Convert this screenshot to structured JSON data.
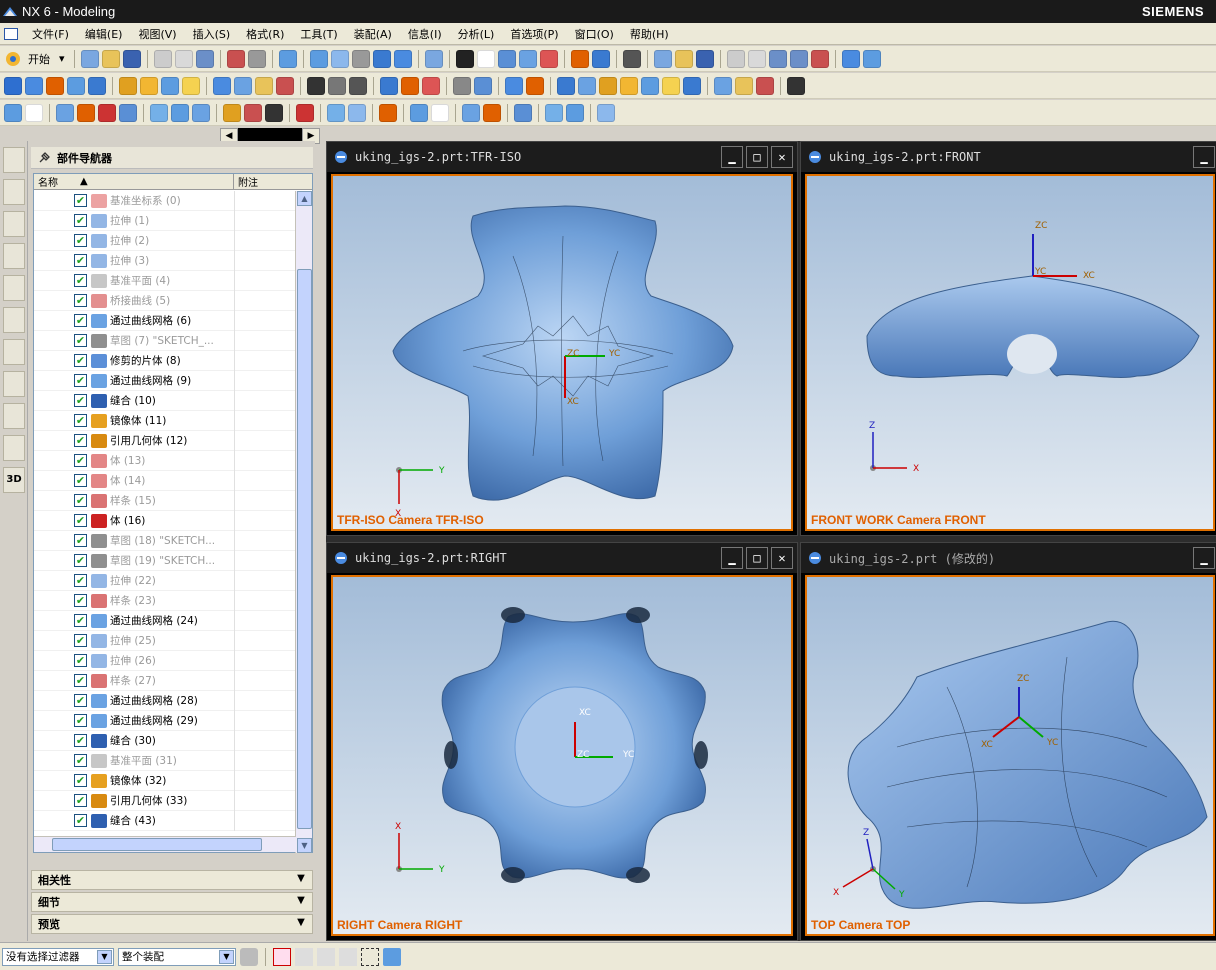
{
  "window": {
    "title": "NX 6 - Modeling",
    "brand": "SIEMENS"
  },
  "menu": [
    "文件(F)",
    "编辑(E)",
    "视图(V)",
    "插入(S)",
    "格式(R)",
    "工具(T)",
    "装配(A)",
    "信息(I)",
    "分析(L)",
    "首选项(P)",
    "窗口(O)",
    "帮助(H)"
  ],
  "toolbar": {
    "start_label": "开始"
  },
  "navigator": {
    "title": "部件导航器",
    "col_name": "名称",
    "col_note": "附注",
    "rows": [
      {
        "label": "基准坐标系 (0)",
        "icon": "datum-csys-icon",
        "dim": true
      },
      {
        "label": "拉伸 (1)",
        "icon": "extrude-icon",
        "dim": true
      },
      {
        "label": "拉伸 (2)",
        "icon": "extrude-icon",
        "dim": true
      },
      {
        "label": "拉伸 (3)",
        "icon": "extrude-icon",
        "dim": true
      },
      {
        "label": "基准平面 (4)",
        "icon": "datum-plane-icon",
        "dim": true
      },
      {
        "label": "桥接曲线 (5)",
        "icon": "bridge-curve-icon",
        "dim": true
      },
      {
        "label": "通过曲线网格 (6)",
        "icon": "curve-mesh-icon",
        "dim": false
      },
      {
        "label": "草图 (7) \"SKETCH_...",
        "icon": "sketch-icon",
        "dim": true
      },
      {
        "label": "修剪的片体 (8)",
        "icon": "trimmed-sheet-icon",
        "dim": false
      },
      {
        "label": "通过曲线网格 (9)",
        "icon": "curve-mesh-icon",
        "dim": false
      },
      {
        "label": "缝合 (10)",
        "icon": "sew-icon",
        "dim": false
      },
      {
        "label": "镜像体 (11)",
        "icon": "mirror-body-icon",
        "dim": false
      },
      {
        "label": "引用几何体 (12)",
        "icon": "instance-geometry-icon",
        "dim": false
      },
      {
        "label": "体 (13)",
        "icon": "body-icon",
        "dim": true
      },
      {
        "label": "体 (14)",
        "icon": "body-icon",
        "dim": true
      },
      {
        "label": "样条 (15)",
        "icon": "spline-icon",
        "dim": true
      },
      {
        "label": "体 (16)",
        "icon": "body-icon",
        "dim": false
      },
      {
        "label": "草图 (18) \"SKETCH...",
        "icon": "sketch-icon",
        "dim": true
      },
      {
        "label": "草图 (19) \"SKETCH...",
        "icon": "sketch-icon",
        "dim": true
      },
      {
        "label": "拉伸 (22)",
        "icon": "extrude-icon",
        "dim": true
      },
      {
        "label": "样条 (23)",
        "icon": "spline-icon",
        "dim": true
      },
      {
        "label": "通过曲线网格 (24)",
        "icon": "curve-mesh-icon",
        "dim": false
      },
      {
        "label": "拉伸 (25)",
        "icon": "extrude-icon",
        "dim": true
      },
      {
        "label": "拉伸 (26)",
        "icon": "extrude-icon",
        "dim": true
      },
      {
        "label": "样条 (27)",
        "icon": "spline-icon",
        "dim": true
      },
      {
        "label": "通过曲线网格 (28)",
        "icon": "curve-mesh-icon",
        "dim": false
      },
      {
        "label": "通过曲线网格 (29)",
        "icon": "curve-mesh-icon",
        "dim": false
      },
      {
        "label": "缝合 (30)",
        "icon": "sew-icon",
        "dim": false
      },
      {
        "label": "基准平面 (31)",
        "icon": "datum-plane-icon",
        "dim": true
      },
      {
        "label": "镜像体 (32)",
        "icon": "mirror-body-icon",
        "dim": false
      },
      {
        "label": "引用几何体 (33)",
        "icon": "instance-geometry-icon",
        "dim": false
      },
      {
        "label": "缝合 (43)",
        "icon": "sew-icon",
        "dim": false
      }
    ],
    "panels": [
      "相关性",
      "细节",
      "预览"
    ]
  },
  "viewports": [
    {
      "title": "uking_igs-2.prt:TFR-ISO",
      "camera": "TFR-ISO Camera TFR-ISO",
      "axes": {
        "a": "Y",
        "b": "X"
      },
      "csys": {
        "z": "ZC",
        "x": "XC",
        "y": "YC"
      }
    },
    {
      "title": "uking_igs-2.prt:FRONT",
      "camera": "FRONT WORK Camera FRONT",
      "axes": {
        "a": "Z",
        "b": "X"
      },
      "csys": {
        "z": "ZC",
        "x": "XC",
        "y": "YC"
      }
    },
    {
      "title": "uking_igs-2.prt:RIGHT",
      "camera": "RIGHT Camera RIGHT",
      "axes": {
        "a": "X",
        "b": "Y"
      },
      "csys": {
        "z": "ZC",
        "x": "XC",
        "y": "YC"
      }
    },
    {
      "title": "uking_igs-2.prt (修改的)",
      "camera": "TOP Camera TOP",
      "axes": {
        "a": "Z",
        "b": "Y",
        "c": "X"
      },
      "csys": {
        "z": "ZC",
        "x": "XC",
        "y": "YC"
      }
    }
  ],
  "status": {
    "filter": "没有选择过滤器",
    "scope": "整个装配"
  },
  "colors": {
    "accent": "#e06000",
    "surface": "#6f9fd8",
    "viewport_bg_top": "#a3bcd8"
  }
}
